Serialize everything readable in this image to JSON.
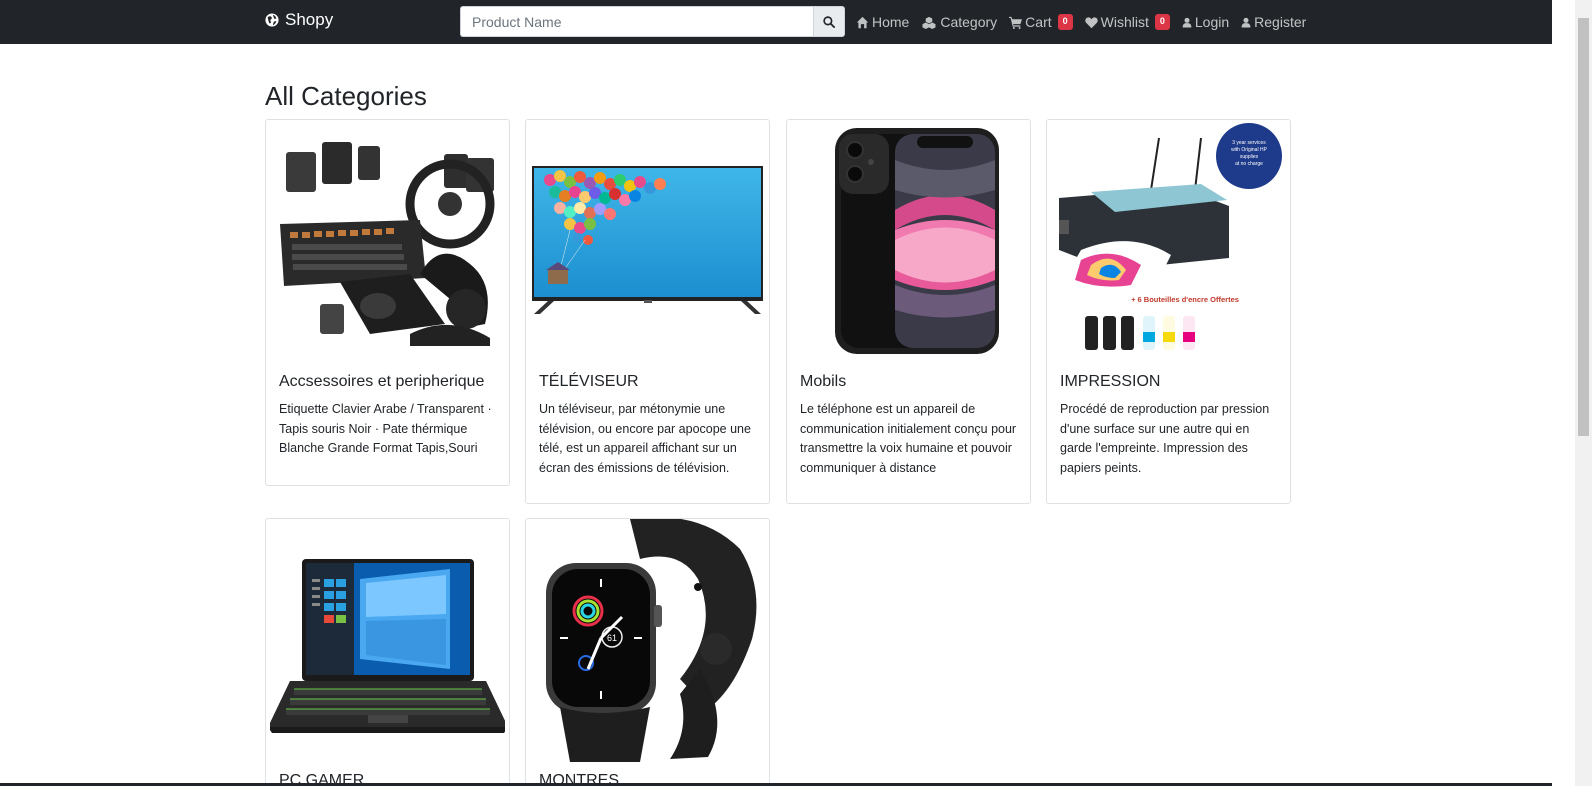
{
  "navbar": {
    "brand": "Shopy",
    "search_placeholder": "Product Name",
    "items": [
      {
        "label": "Home",
        "icon": "home-icon"
      },
      {
        "label": "Category",
        "icon": "cubes-icon"
      },
      {
        "label": "Cart",
        "icon": "cart-icon",
        "badge": "0"
      },
      {
        "label": "Wishlist",
        "icon": "heart-icon",
        "badge": "0"
      },
      {
        "label": "Login",
        "icon": "user-icon"
      },
      {
        "label": "Register",
        "icon": "user-icon"
      }
    ]
  },
  "page": {
    "title": "All Categories"
  },
  "categories": [
    {
      "title": "Accsessoires et peripherique",
      "description": "Etiquette Clavier Arabe / Transparent · Tapis souris Noir · Pate thérmique Blanche Grande Format Tapis,Souri",
      "image": "gaming-accessories-image"
    },
    {
      "title": "TÉLÉVISEUR",
      "description": "Un téléviseur, par métonymie une télévision, ou encore par apocope une télé, est un appareil affichant sur un écran des émissions de télévision.",
      "image": "television-image"
    },
    {
      "title": "Mobils",
      "description": "Le téléphone est un appareil de communication initialement conçu pour transmettre la voix humaine et pouvoir communiquer à distance",
      "image": "smartphone-image"
    },
    {
      "title": "IMPRESSION",
      "description": "Procédé de reproduction par pression d'une surface sur une autre qui en garde l'empreinte. Impression des papiers peints.",
      "image": "printer-image",
      "image_text": [
        "3 year services with Original HP supplies at no charge",
        "+ 6 Bouteilles d'encre Offertes"
      ]
    },
    {
      "title": "PC GAMER",
      "description": "",
      "image": "laptop-image"
    },
    {
      "title": "MONTRES",
      "description": "",
      "image": "smartwatch-image"
    }
  ],
  "colors": {
    "navbar_bg": "#212529",
    "badge": "#dc3545",
    "text": "#212529"
  }
}
